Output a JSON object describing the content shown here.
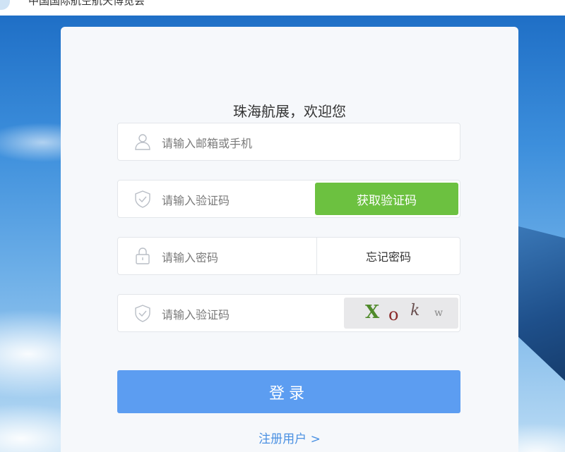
{
  "header": {
    "title": "中国国际航空航天博览会"
  },
  "login": {
    "title": "珠海航展，欢迎您",
    "account_placeholder": "请输入邮箱或手机",
    "sms_code_placeholder": "请输入验证码",
    "get_code_label": "获取验证码",
    "password_placeholder": "请输入密码",
    "forgot_password_label": "忘记密码",
    "captcha_placeholder": "请输入验证码",
    "captcha_chars": [
      "X",
      "o",
      "k",
      "w"
    ],
    "login_label": "登录",
    "register_label": "注册用户 >"
  },
  "colors": {
    "accent_blue": "#5c9df1",
    "get_code_green": "#6cc140",
    "link_blue": "#4a90e2"
  },
  "icons": [
    "user-icon",
    "shield-check-icon",
    "lock-icon"
  ]
}
